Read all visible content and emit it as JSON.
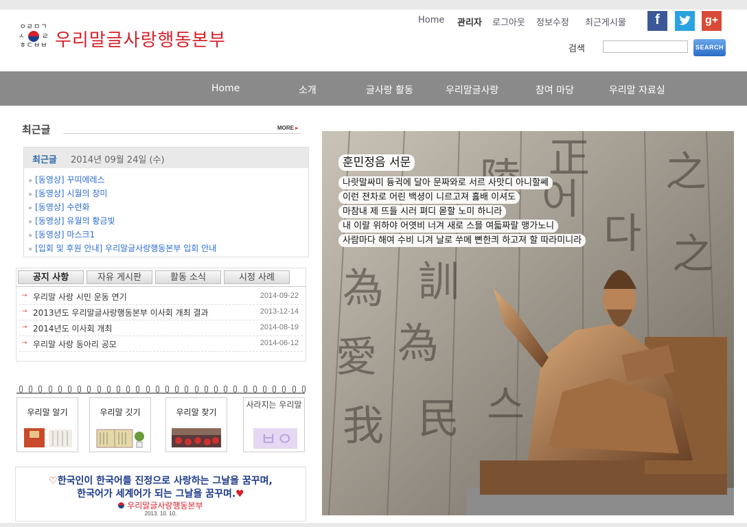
{
  "header": {
    "logo_text": "우리말글사랑행동본부",
    "logo_mark_top": "ㅇㄹㅁㄱ",
    "logo_mark_mid_left": "ㅅ",
    "logo_mark_mid_right": "ㄹ",
    "logo_mark_bottom": "ㅎㄷㅂㅂ",
    "util_links": [
      "Home",
      "관리자",
      "로그아웃",
      "정보수정",
      "최근게시물"
    ],
    "social": [
      "facebook-icon",
      "twitter-icon",
      "google-plus-icon"
    ],
    "search_label": "검색",
    "search_placeholder": "",
    "search_button": "SEARCH"
  },
  "nav": [
    "Home",
    "소개",
    "글사랑 활동",
    "우리말글사랑",
    "참여 마당",
    "우리말 자료실"
  ],
  "recent": {
    "section_title": "최근글",
    "more_label": "MORE",
    "head_label": "최근글",
    "head_date": "2014년 09월 24일 (수)",
    "items": [
      "[동영상] 꾸띠에레스",
      "[동영상] 시월의 장미",
      "[동영상] 수련화",
      "[동영상] 유월의 황금빛",
      "[동영상] 마스크1",
      "[입회 및 후원 안내] 우리말글사랑행동본부 입회 안내"
    ]
  },
  "board": {
    "tabs": [
      "공지 사항",
      "자유 게시판",
      "활동 소식",
      "시정 사례"
    ],
    "rows": [
      {
        "title": "우리말 사랑 시민 운동 연기",
        "date": "2014-09-22"
      },
      {
        "title": "2013년도 우리말글사랑행동본부 이사회 개최 결과",
        "date": "2013-12-14"
      },
      {
        "title": "2014년도 이사회 개최",
        "date": "2014-08-19"
      },
      {
        "title": "우리말 사랑 동아리 공모",
        "date": "2014-06-12"
      }
    ]
  },
  "cards": [
    "우리말 알기",
    "우리말 깃기",
    "우리말 찾기",
    "사라지는 우리말"
  ],
  "banner": {
    "line1": "한국인이 한국어를 진정으로 사랑하는 그날을 꿈꾸며,",
    "line2": "한국어가 세계어가 되는 그날을 꿈꾸며.",
    "org": "우리말글사랑행동본부",
    "date": "2013. 10. 10."
  },
  "hero": {
    "title": "훈민정음 서문",
    "poem": [
      "나랏말싸미 듕귁에 달아 문짜와로 서르 사맛디 아니할쎄",
      "이런 젼차로 어린 백셩이 니르고져 홇배 이셔도",
      "마참내 제 뜨들 시러 펴디 몯할 노미 하니라",
      "내 이랄 위하야 어엿비 너겨 새로 스믈 여듧짜랄 맹가노니",
      "사람마다 해여 수비 니겨 날로 쑤메 뼌한킈 하고져 할 따라미니라"
    ]
  },
  "colors": {
    "brand_red": "#d6202a",
    "nav_gray": "#8a8a8a",
    "link_blue": "#2a6bd0"
  }
}
